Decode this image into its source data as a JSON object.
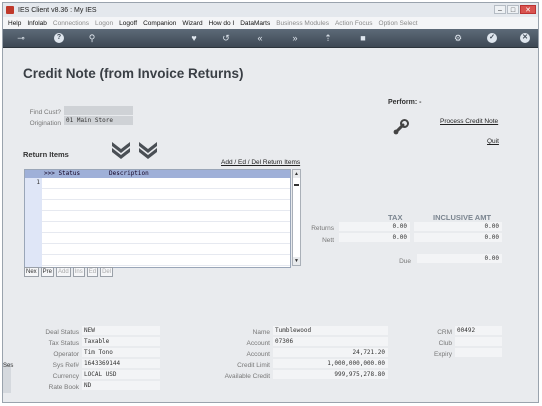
{
  "window": {
    "title": "IES Client v8.36 : My IES"
  },
  "menu": [
    {
      "label": "Help",
      "enabled": true
    },
    {
      "label": "Infolab",
      "enabled": true
    },
    {
      "label": "Connections",
      "enabled": false
    },
    {
      "label": "Logon",
      "enabled": false
    },
    {
      "label": "Logoff",
      "enabled": true
    },
    {
      "label": "Companion",
      "enabled": true
    },
    {
      "label": "Wizard",
      "enabled": true
    },
    {
      "label": "How do I",
      "enabled": true
    },
    {
      "label": "DataMarts",
      "enabled": true
    },
    {
      "label": "Business Modules",
      "enabled": false
    },
    {
      "label": "Action Focus",
      "enabled": false
    },
    {
      "label": "Option Select",
      "enabled": false
    }
  ],
  "page": {
    "title": "Credit Note (from Invoice Returns)"
  },
  "find": {
    "cust_label": "Find Cust?",
    "origination_label": "Origination",
    "origination_value": "01 Main Store"
  },
  "perform": {
    "label": "Perform: -",
    "process_link": "Process Credit Note",
    "quit_link": "Quit"
  },
  "return_items": {
    "title": "Return Items",
    "edit_link": "Add / Ed / Del Return Items",
    "grid_header": ">>> Status        Description",
    "row_number": "1",
    "nav": [
      {
        "label": "Nex",
        "enabled": true
      },
      {
        "label": "Pre",
        "enabled": true
      },
      {
        "label": "Add",
        "enabled": false
      },
      {
        "label": "Ins",
        "enabled": false
      },
      {
        "label": "Ed",
        "enabled": false
      },
      {
        "label": "Del",
        "enabled": false
      }
    ]
  },
  "totals": {
    "tax_header": "TAX",
    "incl_header": "INCLUSIVE AMT",
    "returns_label": "Returns",
    "returns_tax": "0.00",
    "returns_incl": "0.00",
    "nett_label": "Nett",
    "nett_tax": "0.00",
    "nett_incl": "0.00",
    "due_label": "Due",
    "due_value": "0.00"
  },
  "deal": {
    "status_label": "Deal Status",
    "status_value": "NEW",
    "tax_label": "Tax Status",
    "tax_value": "Taxable",
    "operator_label": "Operator",
    "operator_value": "Tim Tono",
    "sys_ref_label": "Sys Ref#",
    "sys_ref_value": "1643369144",
    "currency_label": "Currency",
    "currency_value": "LOCAL USD",
    "rate_book_label": "Rate Book",
    "rate_book_value": "ND"
  },
  "account": {
    "name_label": "Name",
    "name_value": "Tumblewood",
    "account_label": "Account",
    "account_value": "07306",
    "account2_label": "Account",
    "account2_value": "24,721.20",
    "limit_label": "Credit Limit",
    "limit_value": "1,000,000,000.00",
    "avail_label": "Available Credit",
    "avail_value": "999,975,278.80"
  },
  "crm": {
    "crm_label": "CRM",
    "crm_value": "00492",
    "club_label": "Club",
    "expiry_label": "Expiry"
  },
  "side": {
    "tab_label": "Ses"
  },
  "colors": {
    "toolbar": "#4a5563",
    "grid_header": "#9fb0d8",
    "background": "#e9ebee"
  }
}
